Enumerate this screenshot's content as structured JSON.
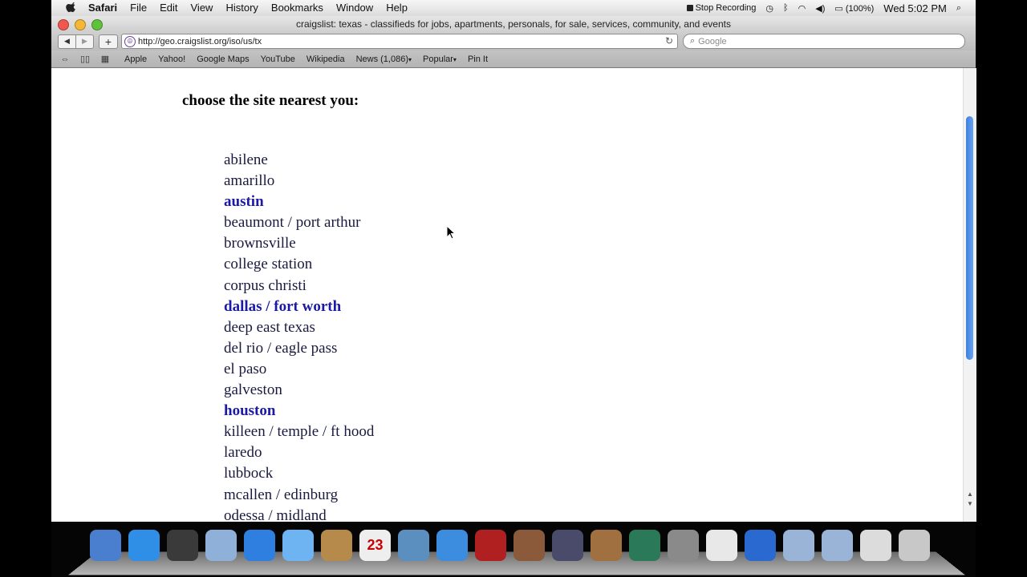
{
  "menubar": {
    "app": "Safari",
    "items": [
      "File",
      "Edit",
      "View",
      "History",
      "Bookmarks",
      "Window",
      "Help"
    ],
    "stop_recording": "Stop Recording",
    "battery": "(100%)",
    "clock": "Wed 5:02 PM"
  },
  "window": {
    "title": "craigslist: texas - classifieds for jobs, apartments, personals, for sale, services, community, and events"
  },
  "toolbar": {
    "url": "http://geo.craigslist.org/iso/us/tx",
    "search_placeholder": "Google"
  },
  "bookmarks": [
    "Apple",
    "Yahoo!",
    "Google Maps",
    "YouTube",
    "Wikipedia",
    "News (1,086)",
    "Popular",
    "Pin It"
  ],
  "page": {
    "heading": "choose the site nearest you:",
    "sites": [
      {
        "name": "abilene",
        "bold": false
      },
      {
        "name": "amarillo",
        "bold": false
      },
      {
        "name": "austin",
        "bold": true
      },
      {
        "name": "beaumont / port arthur",
        "bold": false
      },
      {
        "name": "brownsville",
        "bold": false
      },
      {
        "name": "college station",
        "bold": false
      },
      {
        "name": "corpus christi",
        "bold": false
      },
      {
        "name": "dallas / fort worth",
        "bold": true
      },
      {
        "name": "deep east texas",
        "bold": false
      },
      {
        "name": "del rio / eagle pass",
        "bold": false
      },
      {
        "name": "el paso",
        "bold": false
      },
      {
        "name": "galveston",
        "bold": false
      },
      {
        "name": "houston",
        "bold": true
      },
      {
        "name": "killeen / temple / ft hood",
        "bold": false
      },
      {
        "name": "laredo",
        "bold": false
      },
      {
        "name": "lubbock",
        "bold": false
      },
      {
        "name": "mcallen / edinburg",
        "bold": false
      },
      {
        "name": "odessa / midland",
        "bold": false
      }
    ]
  },
  "dock": {
    "calendar_day": "23",
    "apps": [
      "finder",
      "app-store",
      "dashboard",
      "mail",
      "safari",
      "ichat",
      "address-book",
      "ical",
      "iphoto",
      "itunes",
      "photo-booth",
      "image-capture",
      "imovie",
      "garageband",
      "time-machine",
      "system-preferences",
      "chrome",
      "quicktime",
      "applications-folder",
      "documents-folder",
      "stack",
      "trash"
    ]
  }
}
